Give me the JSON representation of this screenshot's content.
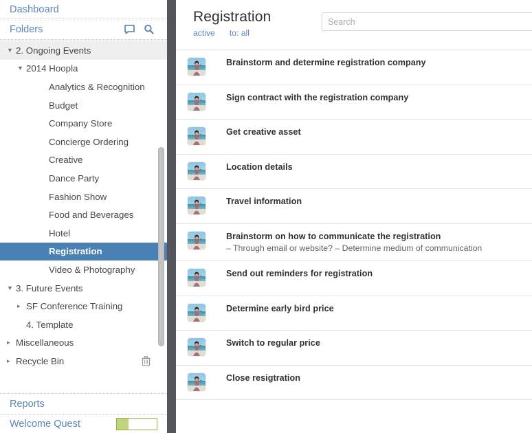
{
  "sidebar": {
    "dashboard_label": "Dashboard",
    "folders_label": "Folders",
    "comment_icon": "comment-icon",
    "search_icon": "search-icon",
    "tree": [
      {
        "label": "2. Ongoing Events",
        "level": 0,
        "twisty": "down",
        "state": "group"
      },
      {
        "label": "2014 Hoopla",
        "level": 1,
        "twisty": "down",
        "state": "normal"
      },
      {
        "label": "Analytics & Recognition",
        "level": 2,
        "twisty": "none",
        "state": "normal"
      },
      {
        "label": "Budget",
        "level": 2,
        "twisty": "none",
        "state": "normal"
      },
      {
        "label": "Company Store",
        "level": 2,
        "twisty": "none",
        "state": "normal"
      },
      {
        "label": "Concierge Ordering",
        "level": 2,
        "twisty": "none",
        "state": "normal"
      },
      {
        "label": "Creative",
        "level": 2,
        "twisty": "none",
        "state": "normal"
      },
      {
        "label": "Dance Party",
        "level": 2,
        "twisty": "none",
        "state": "normal"
      },
      {
        "label": "Fashion Show",
        "level": 2,
        "twisty": "none",
        "state": "normal"
      },
      {
        "label": "Food and Beverages",
        "level": 2,
        "twisty": "none",
        "state": "normal"
      },
      {
        "label": "Hotel",
        "level": 2,
        "twisty": "none",
        "state": "normal"
      },
      {
        "label": "Registration",
        "level": 2,
        "twisty": "none",
        "state": "selected"
      },
      {
        "label": "Video & Photography",
        "level": 2,
        "twisty": "none",
        "state": "normal"
      },
      {
        "label": "3. Future Events",
        "level": 0,
        "twisty": "down",
        "state": "normal"
      },
      {
        "label": "SF Conference Training",
        "level": 1,
        "twisty": "right",
        "state": "normal"
      },
      {
        "label": "4. Template",
        "level": 1,
        "twisty": "none",
        "state": "normal"
      },
      {
        "label": "Miscellaneous",
        "level": 0,
        "twisty": "right",
        "state": "normal"
      },
      {
        "label": "Recycle Bin",
        "level": 0,
        "twisty": "right",
        "state": "normal",
        "trash_icon": "trash-icon"
      }
    ],
    "reports_label": "Reports",
    "quest_label": "Welcome Quest",
    "quest_progress_percent": 30,
    "progress_fill_color": "#c0d482",
    "progress_border_color": "#9aae38",
    "accent_color": "#5b87b8",
    "selected_color": "#4a81b4"
  },
  "main": {
    "title": "Registration",
    "filters": [
      {
        "label": "active"
      },
      {
        "label": "to: all"
      }
    ],
    "search": {
      "placeholder": "Search",
      "value": ""
    },
    "tasks": [
      {
        "title": "Brainstorm and determine registration company",
        "subtitle": "",
        "avatar": "user-photo-avatar"
      },
      {
        "title": "Sign contract with the registration company",
        "subtitle": "",
        "avatar": "user-photo-avatar"
      },
      {
        "title": "Get creative asset",
        "subtitle": "",
        "avatar": "user-photo-avatar"
      },
      {
        "title": "Location details",
        "subtitle": "",
        "avatar": "user-photo-avatar"
      },
      {
        "title": "Travel information",
        "subtitle": "",
        "avatar": "user-photo-avatar"
      },
      {
        "title": "Brainstorm on how to communicate the registration",
        "subtitle": "– Through email or website?  – Determine medium of communication",
        "avatar": "user-photo-avatar"
      },
      {
        "title": "Send out reminders for registration",
        "subtitle": "",
        "avatar": "user-photo-avatar"
      },
      {
        "title": "Determine early bird price",
        "subtitle": "",
        "avatar": "user-photo-avatar"
      },
      {
        "title": "Switch to regular price",
        "subtitle": "",
        "avatar": "user-photo-avatar"
      },
      {
        "title": "Close resigtration",
        "subtitle": "",
        "avatar": "user-photo-avatar"
      }
    ]
  }
}
